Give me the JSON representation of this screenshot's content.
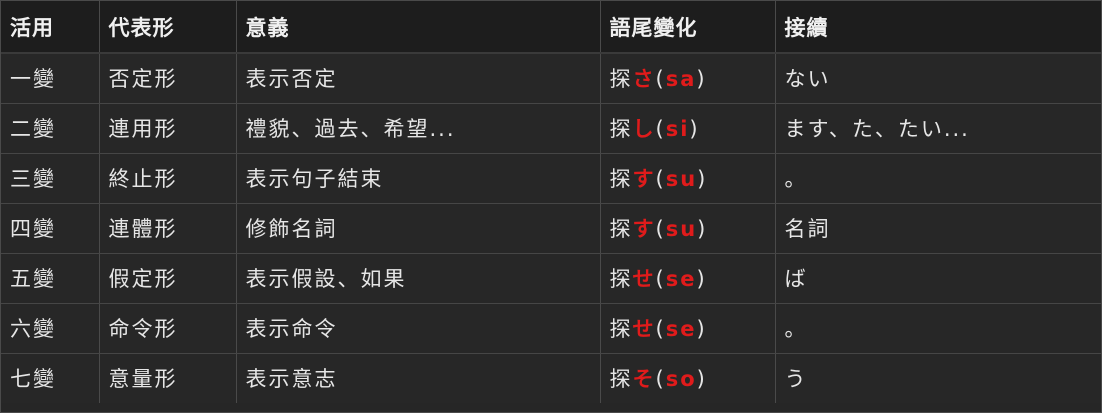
{
  "table": {
    "headers": [
      "活用",
      "代表形",
      "意義",
      "語尾變化",
      "接續"
    ],
    "rows": [
      {
        "form": "一變",
        "name": "否定形",
        "meaning": "表示否定",
        "stem": "探",
        "kana": "さ",
        "romaji": "sa",
        "connect": "ない"
      },
      {
        "form": "二變",
        "name": "連用形",
        "meaning": "禮貌、過去、希望...",
        "stem": "探",
        "kana": "し",
        "romaji": "si",
        "connect": "ます、た、たい..."
      },
      {
        "form": "三變",
        "name": "終止形",
        "meaning": "表示句子結束",
        "stem": "探",
        "kana": "す",
        "romaji": "su",
        "connect": "。"
      },
      {
        "form": "四變",
        "name": "連體形",
        "meaning": "修飾名詞",
        "stem": "探",
        "kana": "す",
        "romaji": "su",
        "connect": "名詞"
      },
      {
        "form": "五變",
        "name": "假定形",
        "meaning": "表示假設、如果",
        "stem": "探",
        "kana": "せ",
        "romaji": "se",
        "connect": "ば"
      },
      {
        "form": "六變",
        "name": "命令形",
        "meaning": "表示命令",
        "stem": "探",
        "kana": "せ",
        "romaji": "se",
        "connect": "。"
      },
      {
        "form": "七變",
        "name": "意量形",
        "meaning": "表示意志",
        "stem": "探",
        "kana": "そ",
        "romaji": "so",
        "connect": "う"
      }
    ],
    "colors": {
      "background": "#262626",
      "header_background": "#1d1d1d",
      "text": "#e6e6e6",
      "highlight": "#e01b1b",
      "border": "#4a4a4a"
    }
  }
}
